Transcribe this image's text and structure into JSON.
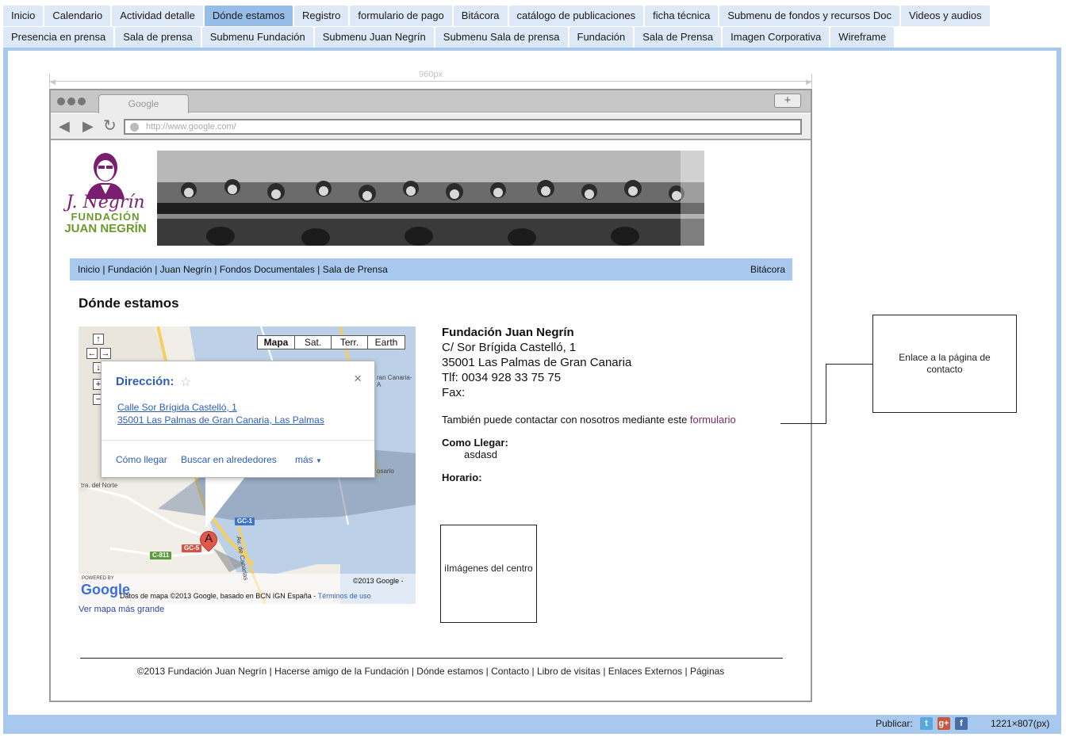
{
  "tabs_row1": [
    "Inicio",
    "Calendario",
    "Actividad detalle",
    "Dónde estamos",
    "Registro",
    "formulario de pago",
    "Bitácora",
    "catálogo de publicaciones",
    "ficha técnica",
    "Submenu de fondos y recursos Doc",
    "Videos y audios"
  ],
  "tabs_row2": [
    "Presencia en prensa",
    "Sala de prensa",
    "Submenu Fundación",
    "Submenu Juan Negrín",
    "Submenu Sala de prensa",
    "Fundación",
    "Sala de Prensa",
    "Imagen Corporativa",
    "Wireframe"
  ],
  "active_tab": "Dónde estamos",
  "ruler": {
    "label": "960px"
  },
  "browser": {
    "tab_label": "Google",
    "new_tab": "+",
    "url": "http://www.google.com/"
  },
  "logo": {
    "signature": "J. Negrín",
    "line1": "FUNDACIÓN",
    "line2": "JUAN NEGRÍN"
  },
  "mainnav": {
    "items": [
      "Inicio",
      "Fundación",
      "Juan Negrín",
      "Fondos Documentales",
      "Sala de Prensa"
    ],
    "separator": " | ",
    "right": "Bitácora"
  },
  "page_title": "Dónde estamos",
  "map": {
    "types": [
      "Mapa",
      "Sat.",
      "Terr.",
      "Earth"
    ],
    "popup": {
      "title": "Dirección:",
      "close": "×",
      "address_line1": "Calle Sor Brígida Castelló, 1",
      "address_line2": "35001 Las Palmas de Gran Canaria, Las Palmas",
      "link_route": "Cómo llegar",
      "link_nearby": "Buscar en alrededores",
      "link_more": "más"
    },
    "marker_label": "A",
    "labels": {
      "norte": "tra. del Norte",
      "avenida": "Av. de Canarias",
      "ran_canaria": "ran Canaria-A",
      "rosario": "osario"
    },
    "road_signs": [
      "GC-1",
      "GC-5",
      "C-811"
    ],
    "powered": "POWERED BY",
    "google": "Google",
    "copyright": "©2013 Google -",
    "data_notice": "Datos de mapa ©2013 Google, basado en BCN IGN España - ",
    "terms": "Términos de uso",
    "bigger_link": "Ver mapa más grande"
  },
  "info": {
    "org": "Fundación Juan Negrín",
    "street": "C/ Sor Brígida Castelló, 1",
    "city": "35001 Las Palmas de Gran Canaria",
    "phone": "Tlf: 0034 928 33 75 75",
    "fax": "Fax:",
    "contact_text": "También puede contactar con nosotros mediante este ",
    "contact_link": "formulario",
    "como_llegar_title": "Como Llegar:",
    "como_llegar_value": "asdasd",
    "horario_title": "Horario:"
  },
  "image_box": "iImágenes del centro",
  "footer": "©2013 Fundación Juan Negrín | Hacerse amigo de la Fundación | Dónde estamos | Contacto | Libro de visitas | Enlaces Externos | Páginas",
  "note": "Enlace a la página de contacto",
  "bottombar": {
    "publicar": "Publicar:",
    "dims": "1221×807(px)"
  },
  "colors": {
    "tab_bg": "#dde9f7",
    "tab_active": "#95bde8",
    "frame": "#a8c8ee",
    "link_blue": "#2d5fb7",
    "form_link": "#7a2a6a",
    "logo_green": "#6a9a2a",
    "logo_purple": "#7a1f6f"
  }
}
